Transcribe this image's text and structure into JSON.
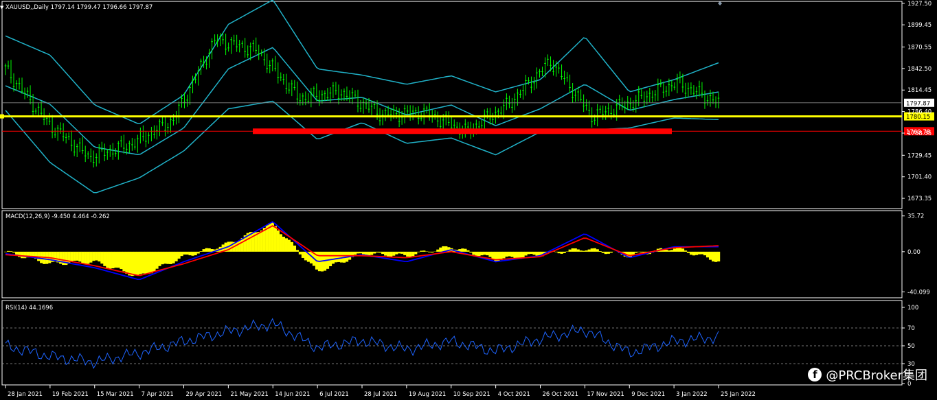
{
  "main": {
    "header": "XAUUSD,,Daily  1797.14 1799.47 1796.66 1797.87",
    "price_ticks": [
      "1927.50",
      "1899.45",
      "1870.55",
      "1842.50",
      "1814.45",
      "1786.40",
      "1758.35",
      "1729.45",
      "1701.40",
      "1673.35"
    ],
    "price_tick_values": [
      1927.5,
      1899.45,
      1870.55,
      1842.5,
      1814.45,
      1786.4,
      1758.35,
      1729.45,
      1701.4,
      1673.35
    ],
    "current_price": {
      "label": "1797.87",
      "value": 1797.87
    },
    "support_yellow": {
      "label": "1780.15",
      "value": 1780.15
    },
    "support_red": {
      "label": "1760.78",
      "value": 1760.78
    }
  },
  "macd": {
    "header": "MACD(12,26,9) -9.450 4.464 -0.262",
    "ticks": [
      "35.72",
      "0.00",
      "-40.099"
    ],
    "tick_values": [
      35.72,
      0,
      -40.099
    ]
  },
  "rsi": {
    "header": "RSI(14) 44.1696",
    "ticks": [
      "100",
      "70",
      "50",
      "30",
      "0"
    ],
    "tick_values": [
      100,
      70,
      50,
      30,
      0
    ],
    "levels": [
      70,
      50,
      30
    ]
  },
  "x_axis": {
    "labels": [
      "28 Jan 2021",
      "19 Feb 2021",
      "15 Mar 2021",
      "7 Apr 2021",
      "29 Apr 2021",
      "21 May 2021",
      "14 Jun 2021",
      "6 Jul 2021",
      "28 Jul 2021",
      "19 Aug 2021",
      "10 Sep 2021",
      "4 Oct 2021",
      "26 Oct 2021",
      "17 Nov 2021",
      "9 Dec 2021",
      "3 Jan 2022",
      "25 Jan 2022"
    ]
  },
  "watermark": "@PRCBroker集团",
  "colors": {
    "background": "#000000",
    "axis": "#ffffff",
    "candle": "#00ff00",
    "bollinger": "#20b2c8",
    "support_yellow": "#ffff00",
    "support_red": "#ff0000",
    "macd_hist": "#ffff00",
    "macd_line": "#0000ff",
    "macd_signal": "#ff0000",
    "rsi_line": "#1e64ff"
  },
  "chart_data": [
    {
      "type": "candlestick",
      "title": "XAUUSD,,Daily",
      "ylim": [
        1673.35,
        1927.5
      ],
      "x": [
        "28 Jan 2021",
        "19 Feb 2021",
        "15 Mar 2021",
        "7 Apr 2021",
        "29 Apr 2021",
        "21 May 2021",
        "14 Jun 2021",
        "6 Jul 2021",
        "28 Jul 2021",
        "19 Aug 2021",
        "10 Sep 2021",
        "4 Oct 2021",
        "26 Oct 2021",
        "17 Nov 2021",
        "9 Dec 2021",
        "3 Jan 2022",
        "25 Jan 2022"
      ],
      "close": [
        1842,
        1772,
        1727,
        1744,
        1775,
        1880,
        1866,
        1804,
        1812,
        1782,
        1785,
        1760,
        1796,
        1852,
        1780,
        1800,
        1824,
        1797.87
      ],
      "close_x": [
        "28 Jan 2021",
        "19 Feb 2021",
        "15 Mar 2021",
        "7 Apr 2021",
        "29 Apr 2021",
        "21 May 2021",
        "14 Jun 2021",
        "6 Jul 2021",
        "28 Jul 2021",
        "19 Aug 2021",
        "10 Sep 2021",
        "4 Oct 2021",
        "26 Oct 2021",
        "17 Nov 2021",
        "9 Dec 2021",
        "3 Jan 2022",
        "25 Jan 2022",
        "28 Jan 2022"
      ],
      "series": [
        {
          "name": "Bollinger Bands",
          "upper": [
            1885,
            1860,
            1795,
            1770,
            1808,
            1900,
            1932,
            1842,
            1834,
            1822,
            1833,
            1812,
            1828,
            1884,
            1812,
            1828,
            1850
          ],
          "middle": [
            1820,
            1796,
            1740,
            1730,
            1765,
            1842,
            1870,
            1800,
            1805,
            1782,
            1795,
            1768,
            1790,
            1822,
            1788,
            1802,
            1812
          ],
          "lower": [
            1788,
            1720,
            1680,
            1700,
            1735,
            1790,
            1800,
            1750,
            1772,
            1745,
            1752,
            1730,
            1760,
            1762,
            1765,
            1778,
            1776
          ]
        }
      ],
      "annotations": [
        {
          "label": "1780.15",
          "value": 1780.15
        },
        {
          "label": "1760.78",
          "value": 1760.78
        },
        {
          "label": "1797.87",
          "value": 1797.87
        }
      ]
    },
    {
      "type": "bar",
      "title": "MACD(12,26,9)",
      "ylim": [
        -40.099,
        35.72
      ],
      "x": [
        "28 Jan 2021",
        "19 Feb 2021",
        "15 Mar 2021",
        "7 Apr 2021",
        "29 Apr 2021",
        "21 May 2021",
        "14 Jun 2021",
        "6 Jul 2021",
        "28 Jul 2021",
        "19 Aug 2021",
        "10 Sep 2021",
        "4 Oct 2021",
        "26 Oct 2021",
        "17 Nov 2021",
        "9 Dec 2021",
        "3 Jan 2022",
        "25 Jan 2022"
      ],
      "series": [
        {
          "name": "MACD",
          "values": [
            0,
            -12,
            -10,
            -25,
            -5,
            8,
            28,
            -20,
            -2,
            -4,
            5,
            -8,
            -3,
            3,
            -4,
            4,
            -9.45
          ]
        },
        {
          "name": "MACD line",
          "values": [
            -2,
            -8,
            -16,
            -28,
            -10,
            5,
            30,
            -10,
            -3,
            -10,
            2,
            -10,
            -4,
            18,
            -6,
            5,
            5
          ]
        },
        {
          "name": "Signal",
          "values": [
            -3,
            -6,
            -14,
            -24,
            -12,
            2,
            26,
            -4,
            -4,
            -6,
            0,
            -8,
            -5,
            14,
            -4,
            4,
            6
          ]
        }
      ]
    },
    {
      "type": "line",
      "title": "RSI(14)",
      "ylim": [
        0,
        100
      ],
      "x": [
        "28 Jan 2021",
        "19 Feb 2021",
        "15 Mar 2021",
        "7 Apr 2021",
        "29 Apr 2021",
        "21 May 2021",
        "14 Jun 2021",
        "6 Jul 2021",
        "28 Jul 2021",
        "19 Aug 2021",
        "10 Sep 2021",
        "4 Oct 2021",
        "26 Oct 2021",
        "17 Nov 2021",
        "9 Dec 2021",
        "3 Jan 2022",
        "25 Jan 2022"
      ],
      "series": [
        {
          "name": "RSI(14)",
          "values": [
            50,
            38,
            32,
            42,
            55,
            66,
            75,
            48,
            56,
            46,
            55,
            44,
            58,
            68,
            42,
            55,
            60
          ]
        }
      ],
      "levels": [
        70,
        50,
        30
      ]
    }
  ]
}
